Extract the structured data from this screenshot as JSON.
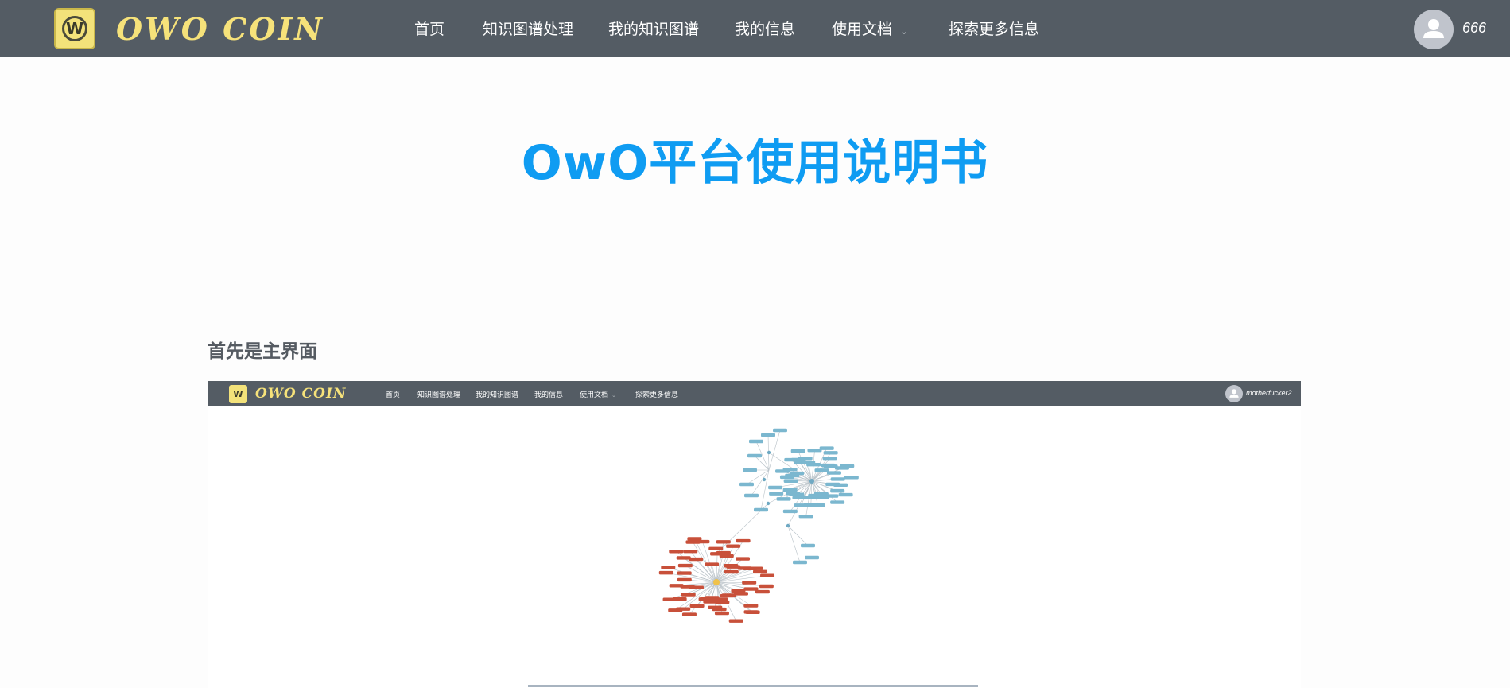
{
  "header": {
    "logo_text": "OWO COIN",
    "logo_badge_letter": "W",
    "nav": [
      {
        "label": "首页"
      },
      {
        "label": "知识图谱处理"
      },
      {
        "label": "我的知识图谱"
      },
      {
        "label": "我的信息"
      },
      {
        "label": "使用文档",
        "has_dropdown": true
      },
      {
        "label": "探索更多信息"
      }
    ],
    "user_name": "666",
    "avatar_icon": "user-avatar-icon",
    "dropdown_icon": "chevron-down-icon"
  },
  "main": {
    "title": "OwO平台使用说明书",
    "section_heading": "首先是主界面"
  },
  "screenshot": {
    "logo_text": "OWO COIN",
    "logo_badge_letter": "W",
    "nav": [
      {
        "label": "首页"
      },
      {
        "label": "知识图谱处理"
      },
      {
        "label": "我的知识图谱"
      },
      {
        "label": "我的信息"
      },
      {
        "label": "使用文档",
        "has_dropdown": true
      },
      {
        "label": "探索更多信息"
      }
    ],
    "user_name": "motherfucker2",
    "graph": {
      "clusters": [
        {
          "name": "blue",
          "color": "#7bb7cf",
          "label_count": 48
        },
        {
          "name": "red",
          "color": "#c8503a",
          "label_count": 60
        }
      ],
      "center_node_color": "#f0c24a"
    }
  },
  "colors": {
    "nav_bg": "#545c64",
    "title_blue": "#0f9cf2",
    "logo_yellow": "#f3e27a",
    "heading_gray": "#555b62"
  }
}
